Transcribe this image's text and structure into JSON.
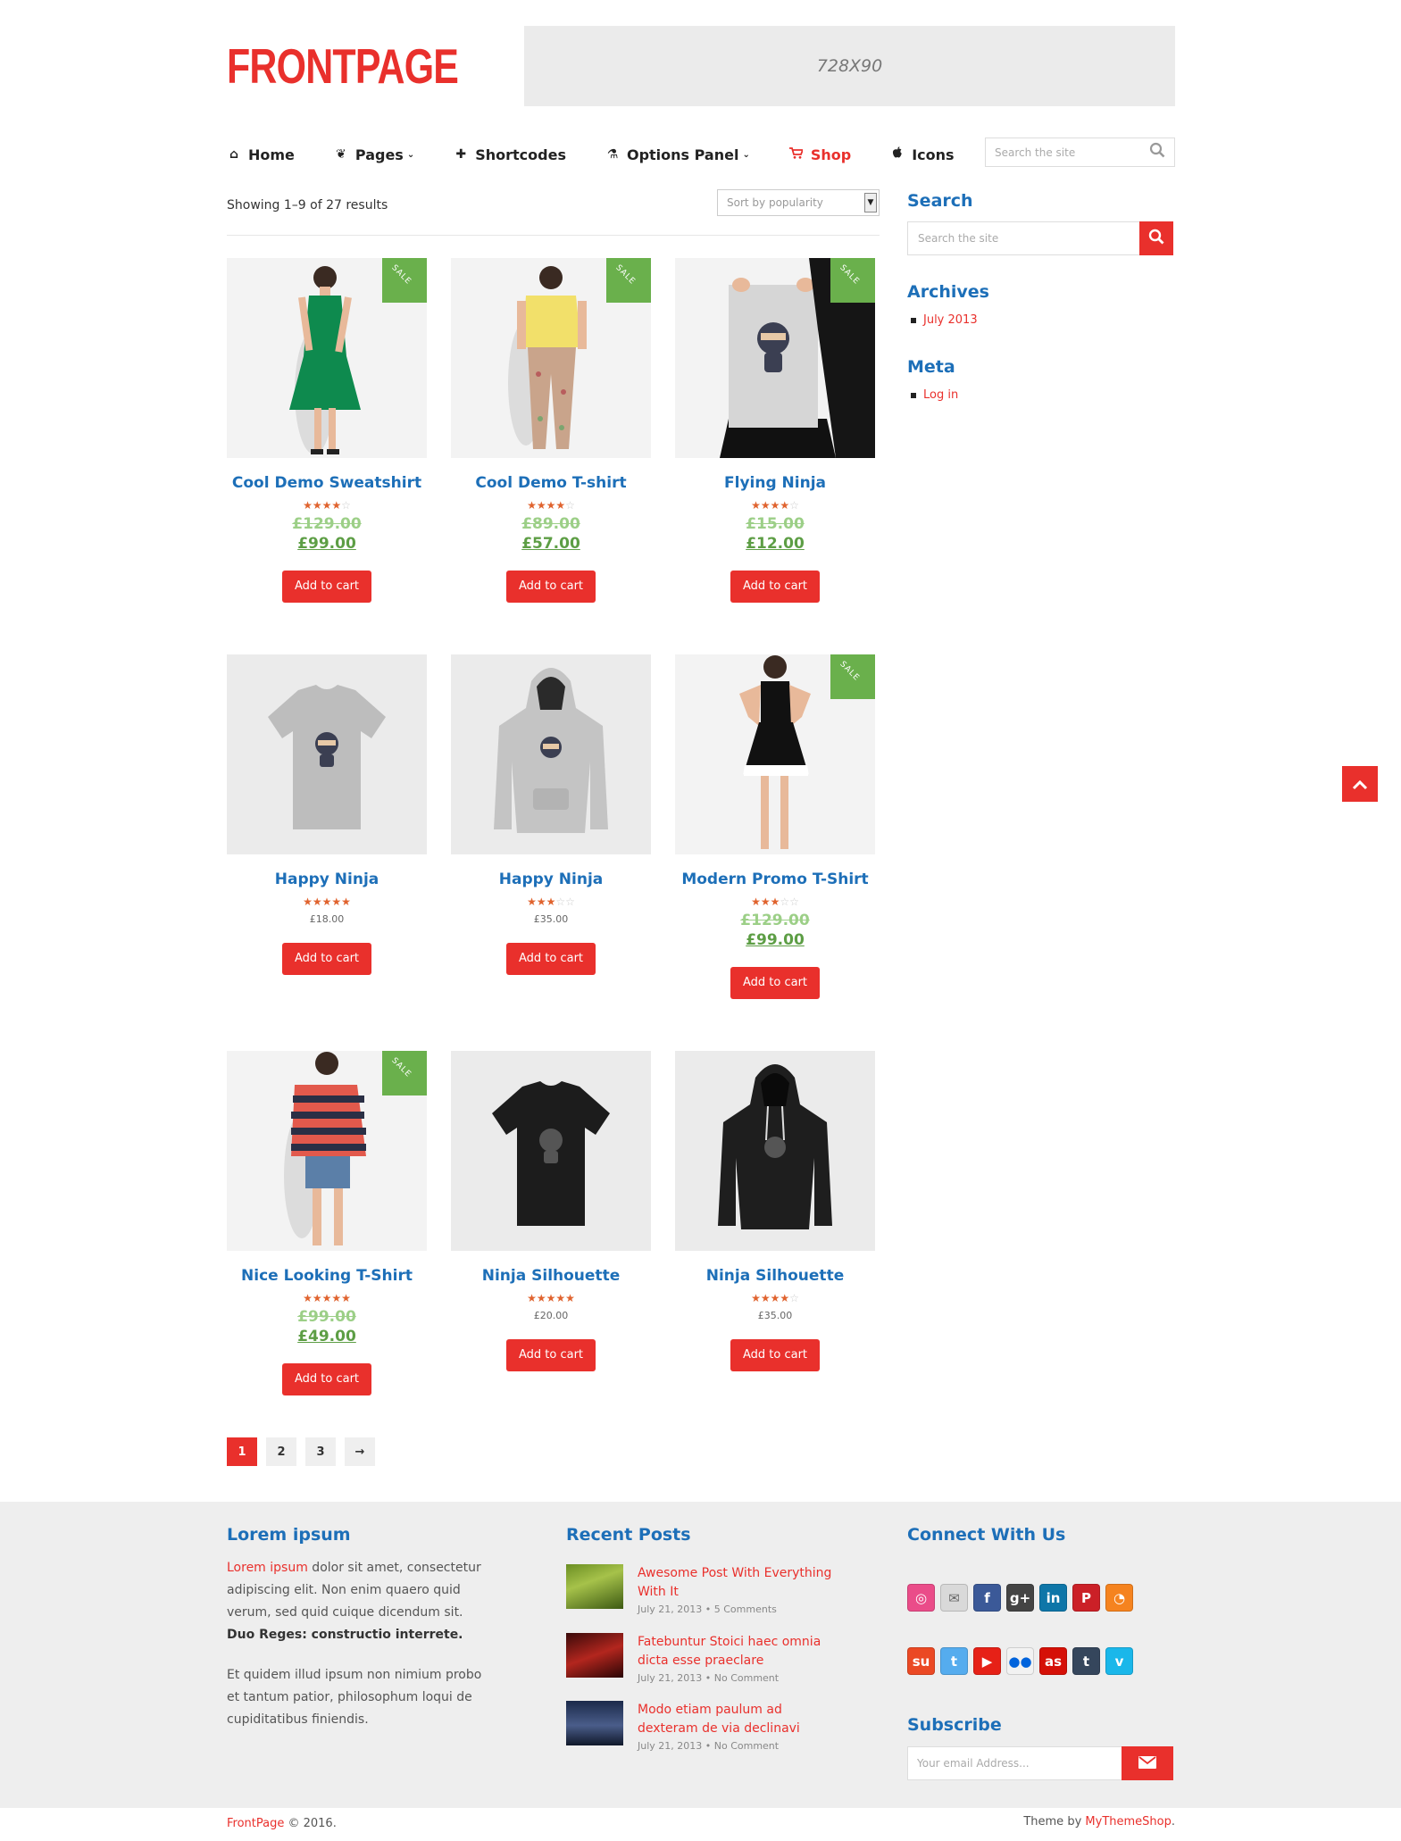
{
  "site": {
    "logo": "FRONTPAGE",
    "ad_label": "728X90"
  },
  "nav": {
    "items": [
      {
        "label": "Home",
        "icon": "home-icon",
        "glyph": "⌂"
      },
      {
        "label": "Pages",
        "icon": "leaf-icon",
        "glyph": "❦",
        "caret": "⌄"
      },
      {
        "label": "Shortcodes",
        "icon": "plus-icon",
        "glyph": "✚"
      },
      {
        "label": "Options Panel",
        "icon": "flask-icon",
        "glyph": "⚗",
        "caret": "⌄"
      },
      {
        "label": "Shop",
        "icon": "cart-icon",
        "glyph": "🛒"
      },
      {
        "label": "Icons",
        "icon": "apple-icon",
        "glyph": ""
      }
    ],
    "search_placeholder": "Search the site"
  },
  "shop": {
    "result_count": "Showing 1–9 of 27 results",
    "sort_selected": "Sort by popularity",
    "sale_badge": "SALE",
    "add_to_cart": "Add to cart",
    "products": [
      {
        "name": "Cool Demo Sweatshirt",
        "rating": 4,
        "old_price": "£129.00",
        "price": "£99.00",
        "sale": true
      },
      {
        "name": "Cool Demo T-shirt",
        "rating": 4,
        "old_price": "£89.00",
        "price": "£57.00",
        "sale": true
      },
      {
        "name": "Flying Ninja",
        "rating": 4,
        "old_price": "£15.00",
        "price": "£12.00",
        "sale": true
      },
      {
        "name": "Happy Ninja",
        "rating": 5,
        "price": "£18.00",
        "sale": false
      },
      {
        "name": "Happy Ninja",
        "rating": 3,
        "price": "£35.00",
        "sale": false
      },
      {
        "name": "Modern Promo T-Shirt",
        "rating": 3,
        "old_price": "£129.00",
        "price": "£99.00",
        "sale": true
      },
      {
        "name": "Nice Looking T-Shirt",
        "rating": 5,
        "old_price": "£99.00",
        "price": "£49.00",
        "sale": true
      },
      {
        "name": "Ninja Silhouette",
        "rating": 5,
        "price": "£20.00",
        "sale": false
      },
      {
        "name": "Ninja Silhouette",
        "rating": 4,
        "price": "£35.00",
        "sale": false
      }
    ]
  },
  "pagination": [
    "1",
    "2",
    "3",
    "→"
  ],
  "sidebar": {
    "search_title": "Search",
    "search_placeholder": "Search the site",
    "archives_title": "Archives",
    "archives": [
      "July 2013"
    ],
    "meta_title": "Meta",
    "meta": [
      "Log in"
    ]
  },
  "footer": {
    "about_title": "Lorem ipsum",
    "about_link": "Lorem ipsum",
    "about_text": " dolor sit amet, consectetur adipiscing elit. Non enim quaero quid verum, sed quid cuique dicendum sit. ",
    "about_bold": "Duo Reges: constructio interrete.",
    "about_text2": "Et quidem illud ipsum non nimium probo et tantum patior, philosophum loqui de cupiditatibus finiendis.",
    "recent_title": "Recent Posts",
    "posts": [
      {
        "title": "Awesome Post With Everything With It",
        "meta": "July 21, 2013 • 5 Comments"
      },
      {
        "title": "Fatebuntur Stoici haec omnia dicta esse praeclare",
        "meta": "July 21, 2013 • No Comment"
      },
      {
        "title": "Modo etiam paulum ad dexteram de via declinavi",
        "meta": "July 21, 2013 • No Comment"
      }
    ],
    "connect_title": "Connect With Us",
    "subscribe_title": "Subscribe",
    "subscribe_placeholder": "Your email Address...",
    "copyright_brand": "FrontPage",
    "copyright_rest": " © 2016.",
    "credit_prefix": "Theme by ",
    "credit_link": "MyThemeShop",
    "credit_suffix": "."
  },
  "colors": {
    "accent": "#e9302c",
    "link_blue": "#1d6fb8",
    "sale_green": "#6ab04c",
    "footer_bg": "#eeeeee"
  }
}
